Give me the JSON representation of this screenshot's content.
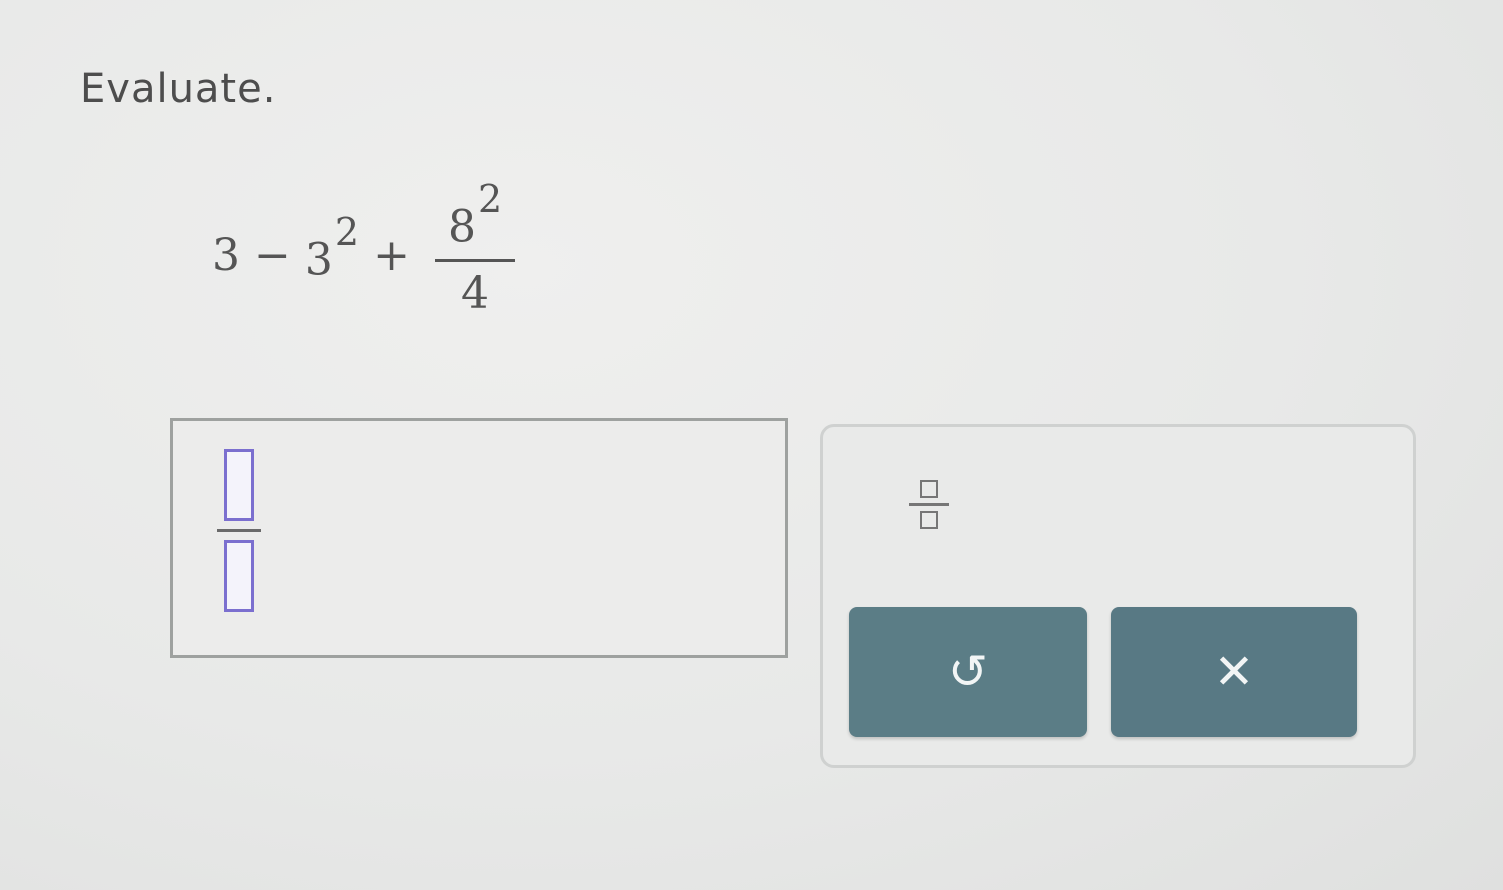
{
  "prompt": "Evaluate.",
  "expression": {
    "term1": "3",
    "op1": "−",
    "term2_base": "3",
    "term2_exp": "2",
    "op2": "+",
    "numerator_base": "8",
    "numerator_exp": "2",
    "denominator": "4"
  },
  "answer": {
    "numerator_value": "",
    "denominator_value": ""
  },
  "keypad": {
    "fraction_icon": "fraction-template-icon",
    "undo_icon": "undo-arrow-icon",
    "undo_glyph": "↺",
    "clear_icon": "close-x-icon",
    "clear_glyph": "✕"
  },
  "colors": {
    "key_background": "#5b7d86",
    "slot_border": "#7b6fcf"
  }
}
